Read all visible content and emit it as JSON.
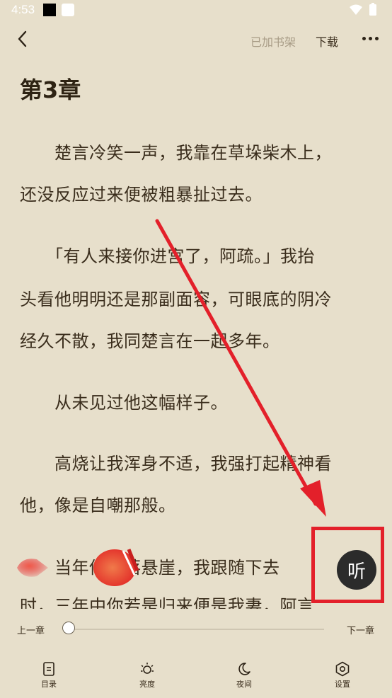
{
  "status_bar": {
    "time": "4:53"
  },
  "toolbar": {
    "shelf_label": "已加书架",
    "download_label": "下载"
  },
  "chapter": {
    "title": "第3章",
    "lines": [
      "　　楚言冷笑一声，我靠在草垛柴木上，",
      "还没反应过来便被粗暴扯过去。",
      "　　「有人来接你进宫了，阿疏。」我抬",
      "头看他明明还是那副面容，可眼底的阴冷",
      "经久不散，我同楚言在一起多年。",
      "　　从未见过他这幅样子。",
      "　　高烧让我浑身不适，我强打起精神看",
      "他，像是自嘲那般。",
      "　　当年你掉落悬崖，我跟随下去",
      "时，三年中你若是归来便是我妻，阿言"
    ]
  },
  "listen_button": {
    "label": "听"
  },
  "progress": {
    "prev_label": "上一章",
    "next_label": "下一章",
    "value": 0.0
  },
  "bottom_nav": [
    {
      "label": "目录",
      "icon": "toc-icon"
    },
    {
      "label": "亮度",
      "icon": "brightness-icon"
    },
    {
      "label": "夜间",
      "icon": "moon-icon"
    },
    {
      "label": "设置",
      "icon": "settings-icon"
    }
  ],
  "colors": {
    "background": "#e7dfcb",
    "text": "#3a2d1c",
    "annotation_red": "#e3202a"
  }
}
